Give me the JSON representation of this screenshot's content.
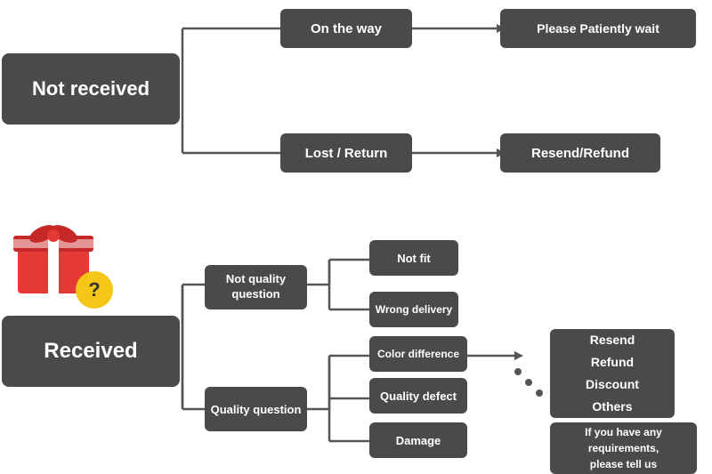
{
  "nodes": {
    "not_received": {
      "label": "Not received"
    },
    "on_the_way": {
      "label": "On the way"
    },
    "please_wait": {
      "label": "Please Patiently wait"
    },
    "lost_return": {
      "label": "Lost / Return"
    },
    "resend_refund_top": {
      "label": "Resend/Refund"
    },
    "received": {
      "label": "Received"
    },
    "not_quality_question": {
      "label": "Not quality\nquestion"
    },
    "quality_question": {
      "label": "Quality question"
    },
    "not_fit": {
      "label": "Not fit"
    },
    "wrong_delivery": {
      "label": "Wrong delivery"
    },
    "color_difference": {
      "label": "Color difference"
    },
    "quality_defect": {
      "label": "Quality defect"
    },
    "damage": {
      "label": "Damage"
    },
    "resend_options": {
      "label": "Resend\nRefund\nDiscount\nOthers"
    },
    "contact_us": {
      "label": "If you have any\nrequirements,\nplease tell us"
    }
  },
  "question_mark": "?",
  "colors": {
    "dark_node": "#4a4a4a",
    "question_bg": "#f5c518",
    "text_dark": "#1a1a1a"
  }
}
